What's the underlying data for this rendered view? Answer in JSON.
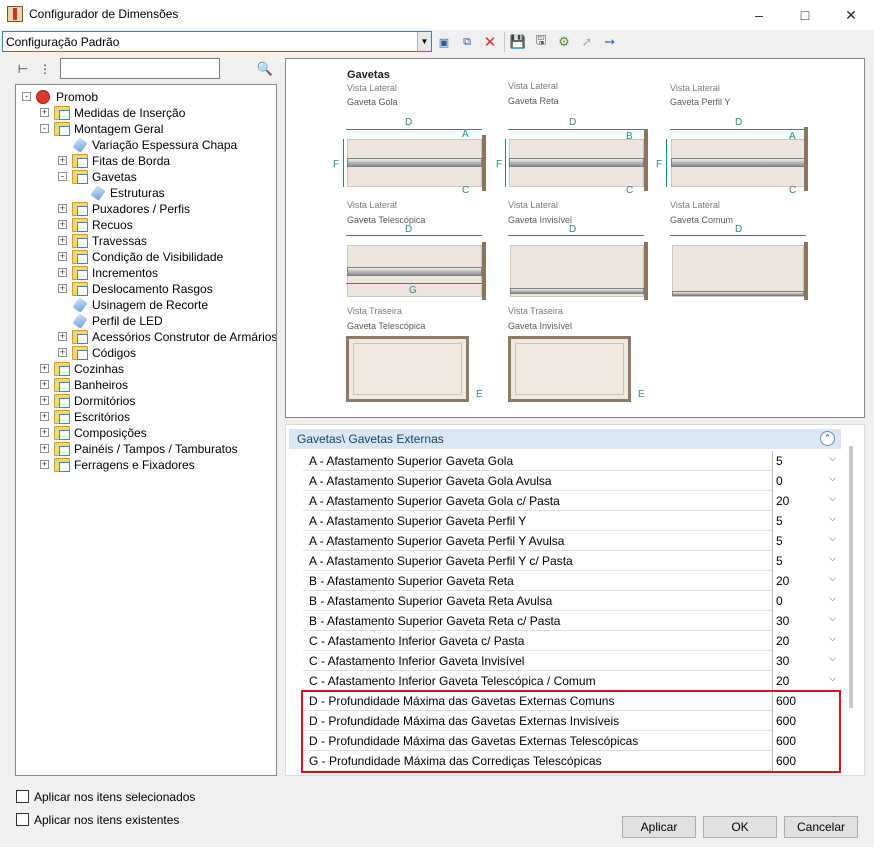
{
  "window": {
    "title": "Configurador de Dimensões"
  },
  "toolbar": {
    "config_value": "Configuração Padrão"
  },
  "tree": {
    "items": [
      {
        "label": "Promob",
        "level": 0,
        "icon": "root",
        "expand": "-"
      },
      {
        "label": "Medidas de Inserção",
        "level": 1,
        "icon": "folder",
        "expand": "+"
      },
      {
        "label": "Montagem Geral",
        "level": 1,
        "icon": "folder",
        "expand": "-"
      },
      {
        "label": "Variação Espessura Chapa",
        "level": 2,
        "icon": "leaf",
        "expand": ""
      },
      {
        "label": "Fitas de Borda",
        "level": 2,
        "icon": "folder",
        "expand": "+"
      },
      {
        "label": "Gavetas",
        "level": 2,
        "icon": "folder",
        "expand": "-"
      },
      {
        "label": "Estruturas",
        "level": 3,
        "icon": "leaf",
        "expand": ""
      },
      {
        "label": "Puxadores / Perfis",
        "level": 2,
        "icon": "folder",
        "expand": "+"
      },
      {
        "label": "Recuos",
        "level": 2,
        "icon": "folder",
        "expand": "+"
      },
      {
        "label": "Travessas",
        "level": 2,
        "icon": "folder",
        "expand": "+"
      },
      {
        "label": "Condição de Visibilidade",
        "level": 2,
        "icon": "folder",
        "expand": "+"
      },
      {
        "label": "Incrementos",
        "level": 2,
        "icon": "folder",
        "expand": "+"
      },
      {
        "label": "Deslocamento Rasgos",
        "level": 2,
        "icon": "folder",
        "expand": "+"
      },
      {
        "label": "Usinagem de Recorte",
        "level": 2,
        "icon": "leaf",
        "expand": ""
      },
      {
        "label": "Perfil de LED",
        "level": 2,
        "icon": "leaf",
        "expand": ""
      },
      {
        "label": "Acessórios Construtor de Armários",
        "level": 2,
        "icon": "folder",
        "expand": "+"
      },
      {
        "label": "Códigos",
        "level": 2,
        "icon": "folder",
        "expand": "+"
      },
      {
        "label": "Cozinhas",
        "level": 1,
        "icon": "folder",
        "expand": "+"
      },
      {
        "label": "Banheiros",
        "level": 1,
        "icon": "folder",
        "expand": "+"
      },
      {
        "label": "Dormitórios",
        "level": 1,
        "icon": "folder",
        "expand": "+"
      },
      {
        "label": "Escritórios",
        "level": 1,
        "icon": "folder",
        "expand": "+"
      },
      {
        "label": "Composições",
        "level": 1,
        "icon": "folder",
        "expand": "+"
      },
      {
        "label": "Painéis / Tampos / Tamburatos",
        "level": 1,
        "icon": "folder",
        "expand": "+"
      },
      {
        "label": "Ferragens e Fixadores",
        "level": 1,
        "icon": "folder",
        "expand": "+"
      }
    ]
  },
  "preview": {
    "title": "Gavetas",
    "vista_lateral": "Vista Lateral",
    "vista_traseira": "Vista Traseira",
    "names": {
      "gola": "Gaveta Gola",
      "reta": "Gaveta Reta",
      "perfil_y": "Gaveta Perfil Y",
      "telescopica": "Gaveta Telescópica",
      "invisivel": "Gaveta Invisível",
      "comum": "Gaveta Comum"
    },
    "letters": {
      "a": "A",
      "b": "B",
      "c": "C",
      "d": "D",
      "e": "E",
      "f": "F",
      "g": "G"
    }
  },
  "grid": {
    "header": "Gavetas\\ Gavetas Externas",
    "rows": [
      {
        "label": "A - Afastamento Superior Gaveta Gola",
        "value": "5",
        "dropdown": true
      },
      {
        "label": "A - Afastamento Superior Gaveta Gola Avulsa",
        "value": "0",
        "dropdown": true
      },
      {
        "label": "A - Afastamento Superior Gaveta Gola c/ Pasta",
        "value": "20",
        "dropdown": true
      },
      {
        "label": "A - Afastamento Superior Gaveta Perfil Y",
        "value": "5",
        "dropdown": true
      },
      {
        "label": "A - Afastamento Superior Gaveta Perfil Y Avulsa",
        "value": "5",
        "dropdown": true
      },
      {
        "label": "A - Afastamento Superior Gaveta Perfil Y c/ Pasta",
        "value": "5",
        "dropdown": true
      },
      {
        "label": "B - Afastamento Superior Gaveta Reta",
        "value": "20",
        "dropdown": true
      },
      {
        "label": "B - Afastamento Superior Gaveta Reta Avulsa",
        "value": "0",
        "dropdown": true
      },
      {
        "label": "B - Afastamento Superior Gaveta Reta c/ Pasta",
        "value": "30",
        "dropdown": true
      },
      {
        "label": "C - Afastamento Inferior Gaveta c/ Pasta",
        "value": "20",
        "dropdown": true
      },
      {
        "label": "C - Afastamento Inferior Gaveta Invisível",
        "value": "30",
        "dropdown": true
      },
      {
        "label": "C - Afastamento Inferior Gaveta Telescópica / Comum",
        "value": "20",
        "dropdown": true
      },
      {
        "label": "D - Profundidade Máxima das Gavetas Externas Comuns",
        "value": "600",
        "dropdown": false
      },
      {
        "label": "D - Profundidade Máxima das Gavetas Externas Invisíveis",
        "value": "600",
        "dropdown": false
      },
      {
        "label": "D - Profundidade Máxima das Gavetas Externas Telescópicas",
        "value": "600",
        "dropdown": false
      },
      {
        "label": "G - Profundidade Máxima das Corrediças Telescópicas",
        "value": "600",
        "dropdown": false
      }
    ]
  },
  "options": {
    "apply_selected": "Aplicar nos itens selecionados",
    "apply_existing": "Aplicar nos itens existentes"
  },
  "buttons": {
    "apply": "Aplicar",
    "ok": "OK",
    "cancel": "Cancelar"
  },
  "icons": {
    "minimize": "minimize-icon",
    "maximize": "maximize-icon",
    "close": "close-icon"
  },
  "colors": {
    "highlight": "#d4141c",
    "header_bg": "#dae7f5",
    "dimension": "#2e8c7c",
    "delete": "#d32f2f"
  }
}
